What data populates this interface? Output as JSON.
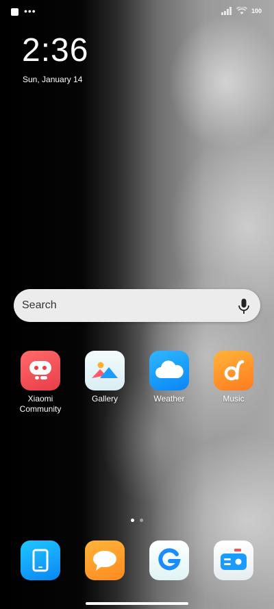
{
  "status_bar": {
    "battery_level": "100",
    "left_icons": [
      "square-notification-icon",
      "more-dots-icon"
    ],
    "right_icons": [
      "signal-icon",
      "wifi-icon",
      "battery-icon"
    ]
  },
  "lock_info": {
    "time": "2:36",
    "date": "Sun, January 14"
  },
  "search": {
    "placeholder": "Search",
    "icon": "microphone-icon"
  },
  "apps": [
    {
      "label": "Xiaomi Community",
      "icon": "xiaomi-community-icon"
    },
    {
      "label": "Gallery",
      "icon": "gallery-icon"
    },
    {
      "label": "Weather",
      "icon": "weather-icon"
    },
    {
      "label": "Music",
      "icon": "music-icon"
    }
  ],
  "dock": [
    {
      "icon": "tablet-icon"
    },
    {
      "icon": "messages-icon"
    },
    {
      "icon": "google-icon"
    },
    {
      "icon": "radio-icon"
    }
  ],
  "pager": {
    "pages": 2,
    "active": 1
  }
}
